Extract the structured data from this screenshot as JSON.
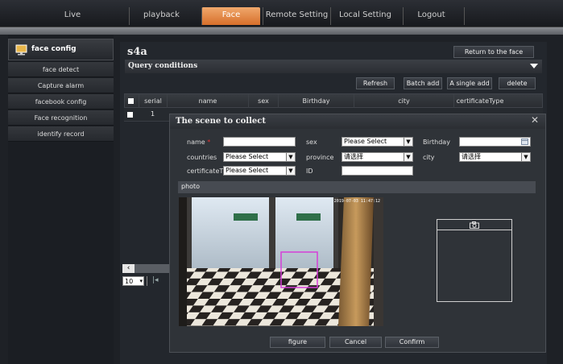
{
  "nav": {
    "items": [
      "Live",
      "playback",
      "Face",
      "Remote Setting",
      "Local Setting",
      "Logout"
    ],
    "active": "Face"
  },
  "sidebar": {
    "title": "face config",
    "items": [
      "face detect",
      "Capture alarm",
      "facebook config",
      "Face recognition",
      "identify record"
    ]
  },
  "main": {
    "title": "s4a",
    "return_button": "Return to the face",
    "query_title": "Query conditions",
    "actions": [
      "Refresh",
      "Batch add",
      "A single add",
      "delete"
    ],
    "table": {
      "columns": [
        "serial",
        "name",
        "sex",
        "Birthday",
        "city",
        "certificateType"
      ],
      "rows": [
        {
          "serial": "1"
        }
      ]
    },
    "pager": {
      "page_size": "10"
    }
  },
  "modal": {
    "title": "The scene to collect",
    "fields": {
      "name_label": "name",
      "sex_label": "sex",
      "sex_value": "Please Select",
      "birthday_label": "Birthday",
      "countries_label": "countries",
      "countries_value": "Please Select",
      "province_label": "province",
      "province_value": "请选择",
      "city_label": "city",
      "city_value": "请选择",
      "cert_label": "certificateT",
      "cert_value": "Please Select",
      "id_label": "ID"
    },
    "photo_label": "photo",
    "camera_timestamp": "2019-07-03 11:47:12",
    "buttons": {
      "figure": "figure",
      "cancel": "Cancel",
      "confirm": "Confirm"
    }
  },
  "colors": {
    "accent": "#e88a45",
    "selection_box": "#d63fd8"
  }
}
